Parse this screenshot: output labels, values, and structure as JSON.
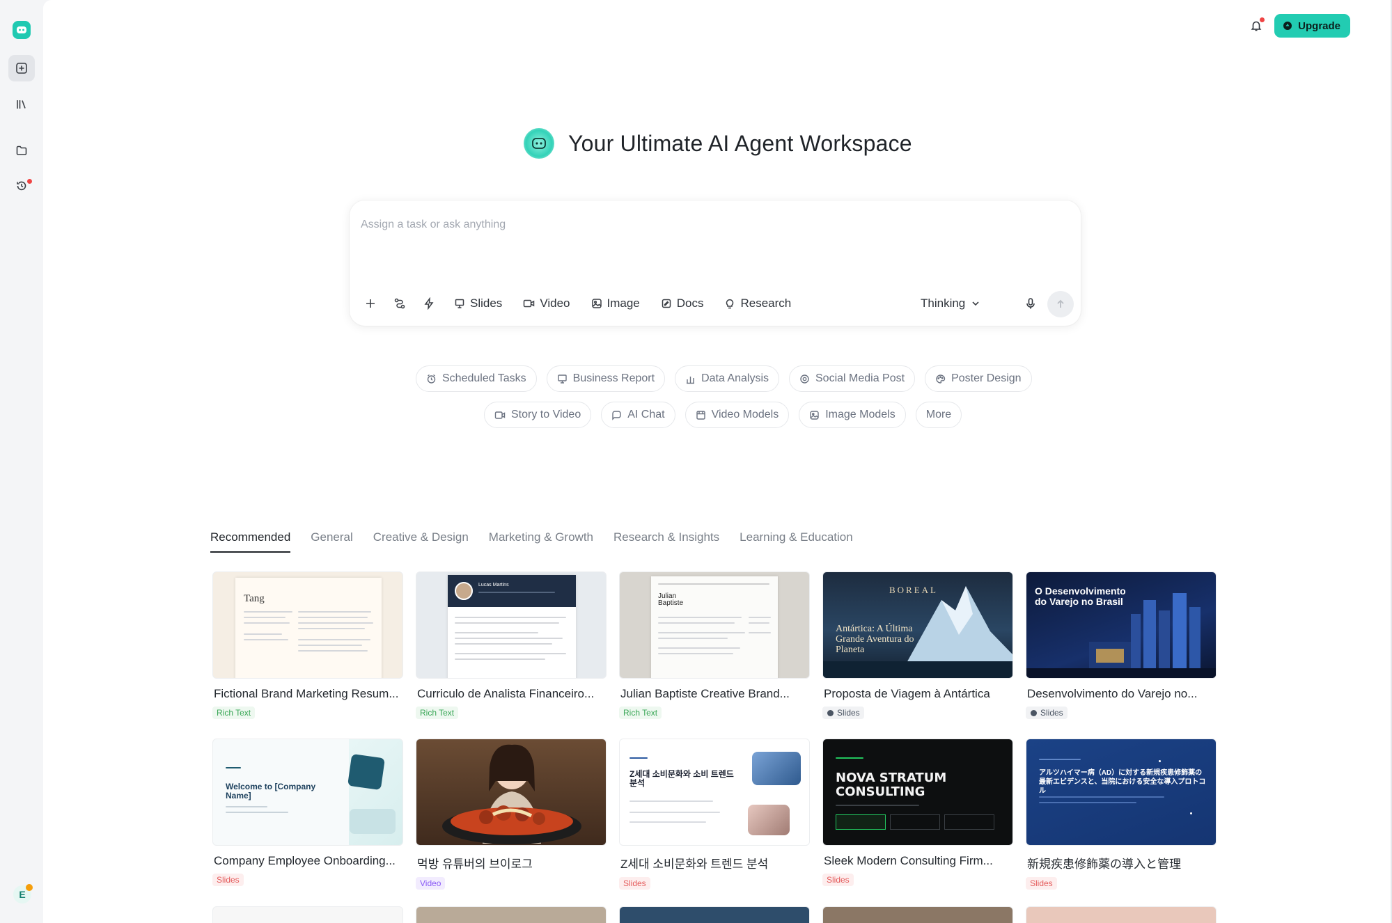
{
  "header": {
    "upgrade_label": "Upgrade"
  },
  "hero": {
    "title": "Your Ultimate AI Agent Workspace"
  },
  "composer": {
    "placeholder": "Assign a task or ask anything",
    "modes": [
      "Slides",
      "Video",
      "Image",
      "Docs",
      "Research"
    ],
    "thinking_label": "Thinking"
  },
  "suggestions": {
    "row1": [
      "Scheduled Tasks",
      "Business Report",
      "Data Analysis",
      "Social Media Post",
      "Poster Design"
    ],
    "row2": [
      "Story to Video",
      "AI Chat",
      "Video Models",
      "Image Models",
      "More"
    ]
  },
  "tabs": [
    "Recommended",
    "General",
    "Creative & Design",
    "Marketing & Growth",
    "Research & Insights",
    "Learning & Education"
  ],
  "cards": [
    {
      "title": "Fictional Brand Marketing Resum...",
      "tag": "Rich Text",
      "thumb_text": "Tang"
    },
    {
      "title": "Curriculo de Analista Financeiro...",
      "tag": "Rich Text",
      "thumb_text": "Lucas Martins"
    },
    {
      "title": "Julian Baptiste Creative Brand...",
      "tag": "Rich Text",
      "thumb_text": "Julian Baptiste"
    },
    {
      "title": "Proposta de Viagem à Antártica",
      "tag": "Slides",
      "thumb_text": "BOREAL",
      "thumb_sub": "Antártica: A Última Grande Aventura do Planeta"
    },
    {
      "title": "Desenvolvimento do Varejo no...",
      "tag": "Slides",
      "thumb_text": "O Desenvolvimento do Varejo no Brasil"
    },
    {
      "title": "Company Employee Onboarding...",
      "tag": "Slides",
      "thumb_text": "Welcome to [Company Name]"
    },
    {
      "title": "먹방 유튜버의 브이로그",
      "tag": "Video"
    },
    {
      "title": "Z세대 소비문화와 트렌드 분석",
      "tag": "Slides",
      "thumb_text": "Z세대 소비문화와 소비 트렌드 분석"
    },
    {
      "title": "Sleek Modern Consulting Firm...",
      "tag": "Slides",
      "thumb_text": "NOVA STRATUM CONSULTING"
    },
    {
      "title": "新規疾患修飾薬の導入と管理",
      "tag": "Slides",
      "thumb_text": "アルツハイマー病（AD）に対する新規疾患修飾薬の最新エビデンスと、当院における安全な導入プロトコル"
    }
  ],
  "colors": {
    "accent": "#22ccb2",
    "notify": "#ef4444"
  }
}
